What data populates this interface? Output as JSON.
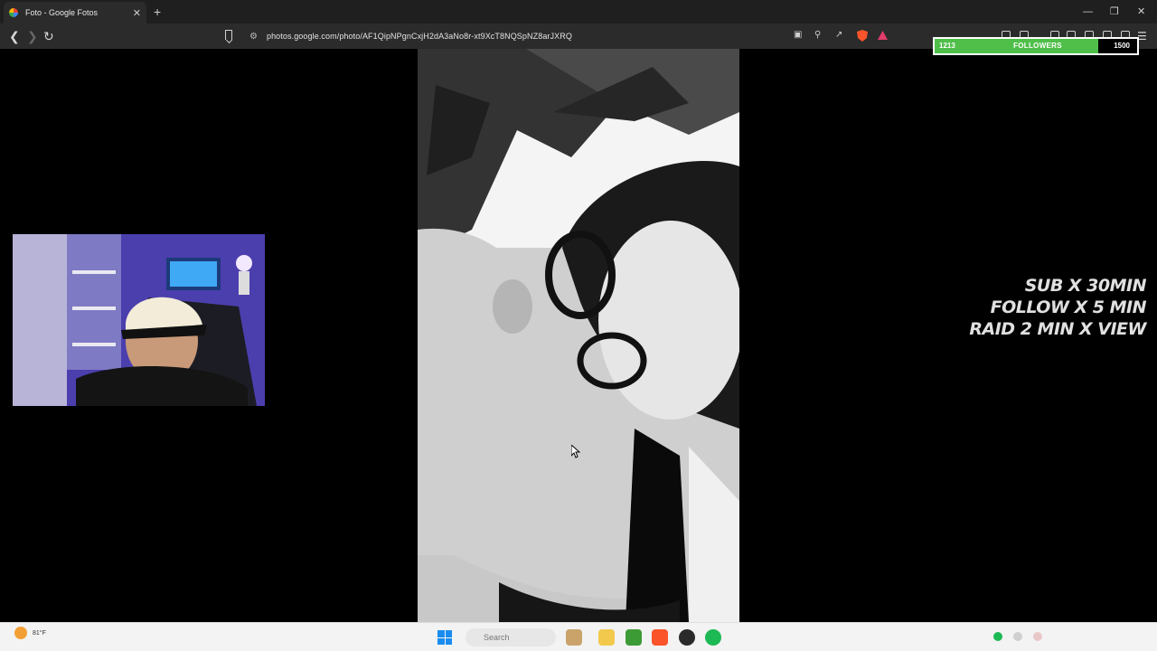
{
  "browser": {
    "tab_title": "Foto - Google Fotos",
    "tab_close": "✕",
    "new_tab": "+",
    "url": "photos.google.com/photo/AF1QipNPgnCxjH2dA3aNo8r-xt9XcT8NQSpNZ8arJXRQ"
  },
  "stream_overlay": {
    "followers": {
      "current": "1213",
      "label": "FOLLOWERS",
      "goal": "1500",
      "progress": 0.809
    },
    "rules": {
      "line1": "SUB X 30MIN",
      "line2": "FOLLOW X 5 MIN",
      "line3": "RAID 2 MIN X VIEW"
    }
  },
  "taskbar": {
    "weather_temp": "81°F",
    "search_placeholder": "Search"
  },
  "colors": {
    "goal_fill": "#4fbf4a",
    "tab_bg": "#2b2b2b",
    "chrome_bg": "#1f1f1f",
    "start_blue": "#1a8cf0",
    "spotify_green": "#1db954",
    "brave_orange": "#fb542b"
  }
}
